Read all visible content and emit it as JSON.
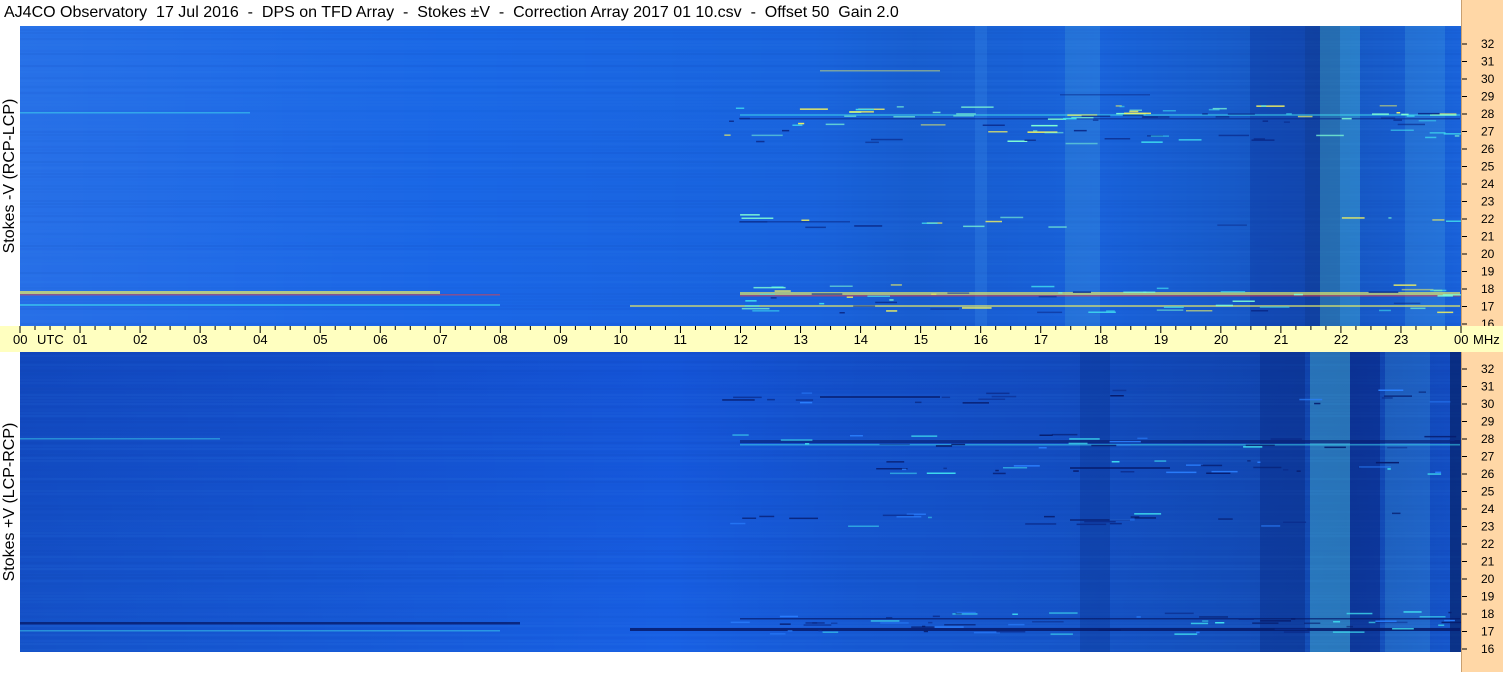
{
  "title": "AJ4CO Observatory  17 Jul 2016  -  DPS on TFD Array  -  Stokes ±V  -  Correction Array 2017 01 10.csv  -  Offset 50  Gain 2.0",
  "chart_data": {
    "type": "heatmap",
    "x": {
      "unit": "UTC",
      "range": [
        0,
        24
      ],
      "tick_labels": [
        "00",
        "01",
        "02",
        "03",
        "04",
        "05",
        "06",
        "07",
        "08",
        "09",
        "10",
        "11",
        "12",
        "13",
        "14",
        "15",
        "16",
        "17",
        "18",
        "19",
        "20",
        "21",
        "22",
        "23",
        "00"
      ]
    },
    "y": {
      "unit": "MHz",
      "range": [
        16,
        32
      ],
      "tick_labels": [
        "32",
        "31",
        "30",
        "29",
        "28",
        "27",
        "26",
        "25",
        "24",
        "23",
        "22",
        "21",
        "20",
        "19",
        "18",
        "17",
        "16"
      ]
    },
    "panels": [
      {
        "label": "Stokes -V (RCP-LCP)"
      },
      {
        "label": "Stokes +V (LCP-RCP)"
      }
    ],
    "colors": {
      "background_blue": "#1a66e6",
      "dark_blue": "#0a2a8a",
      "cyan": "#40e0f0",
      "yellow": "#f0f060",
      "red": "#f04040",
      "time_bar": "#ffffc0",
      "freq_bar": "#ffd7a6"
    }
  }
}
